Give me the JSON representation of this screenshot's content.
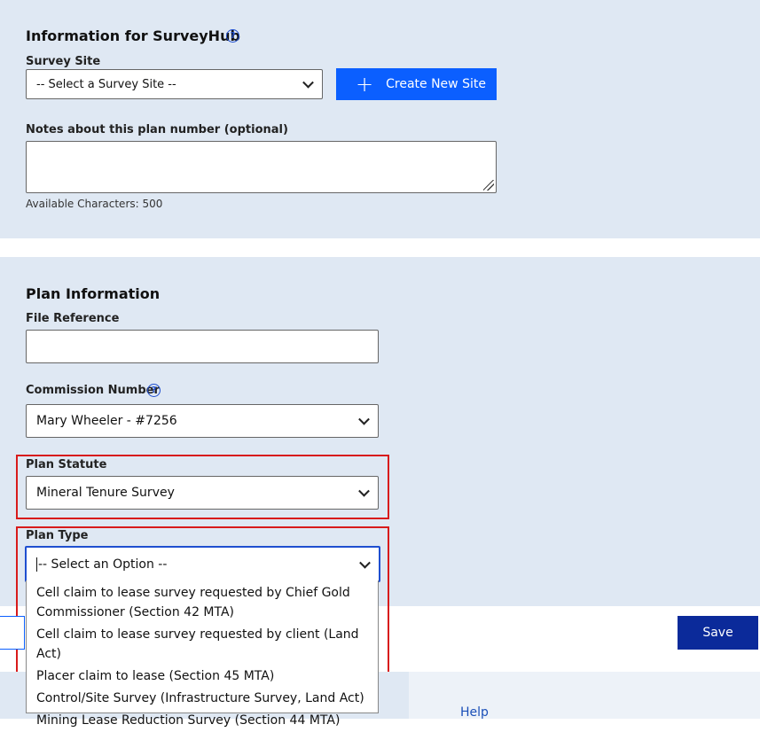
{
  "surveyhub": {
    "title": "Information for SurveyHub",
    "survey_site_label": "Survey Site",
    "survey_site_value": "-- Select a Survey Site --",
    "create_site_label": "Create New Site",
    "notes_label": "Notes about this plan number (optional)",
    "notes_value": "",
    "available_chars": "Available Characters: 500"
  },
  "plan": {
    "title": "Plan Information",
    "file_reference_label": "File Reference",
    "file_reference_value": "",
    "commission_label": "Commission Number",
    "commission_value": "Mary Wheeler - #7256",
    "statute_label": "Plan Statute",
    "statute_value": "Mineral Tenure Survey",
    "type_label": "Plan Type",
    "type_value": "-- Select an Option --",
    "type_options": [
      "Cell claim to lease survey requested by Chief Gold Commissioner (Section 42 MTA)",
      "Cell claim to lease survey requested by client (Land Act)",
      "Placer claim to lease (Section 45 MTA)",
      "Control/Site Survey (Infrastructure Survey, Land Act)",
      "Mining Lease Reduction Survey (Section 44 MTA)"
    ]
  },
  "actions": {
    "save_label": "Save"
  },
  "footer": {
    "help_label": "Help"
  },
  "colors": {
    "accent": "#0b5fff",
    "save": "#0b2a9a",
    "panel": "#dfe8f3",
    "highlight": "#d81b1b"
  }
}
